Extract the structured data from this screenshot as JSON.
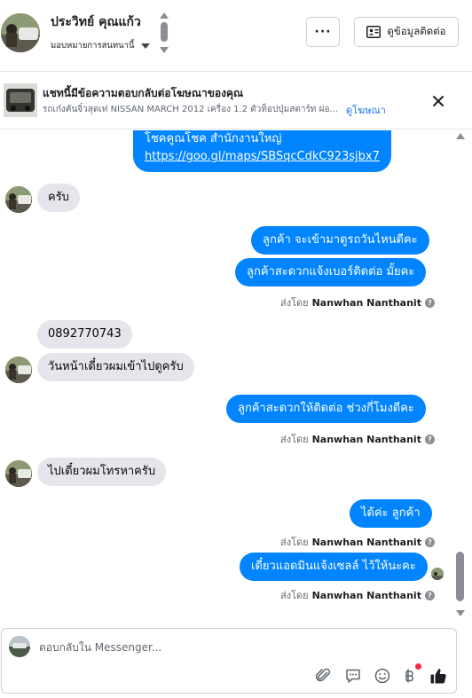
{
  "header": {
    "contact_name": "ประวิทย์ คุณแก้ว",
    "assign_label": "มอบหมายการสนทนานี้",
    "more_label": "···",
    "view_contact_label": "ดูข้อมูลติดต่อ"
  },
  "ad_banner": {
    "title": "แชทนี้มีข้อความตอบกลับต่อโฆษณาของคุณ",
    "subtitle": "รถเก๋งคันจิ๋วสุดเท่ NISSAN MARCH 2012 เครื่อง 1.2 ตัวท็อปปุ่มสตาร์ท ผ่อ...",
    "see_ad_label": "ดูโฆษณา"
  },
  "messages": {
    "m1_line1": "โชคคูณโชค สำนักงานใหญ่",
    "m1_link": "https://goo.gl/maps/SBSqcCdkC923sjbx7",
    "m2": "ครับ",
    "m3": "ลูกค้า จะเข้ามาดูรถวันไหนดีคะ",
    "m4": "ลูกค้าสะดวกแจ้งเบอร์ติดต่อ มั้ยคะ",
    "m5": "0892770743",
    "m6": "วันหน้าเดี๋ยวผมเข้าไปดูครับ",
    "m7": "ลูกค้าสะดวกให้ติดต่อ ช่วงกี่โมงดีคะ",
    "m8": "ไปเดี๋ยวผมโทรหาครับ",
    "m9": "ได้ค่ะ ลูกค้า",
    "m10": "เดี๋ยวแอดมินแจ้งเซลล์ ไว้ให้นะคะ"
  },
  "sent_by": {
    "prefix": "ส่งโดย",
    "sender": "Nanwhan Nanthanit",
    "help": "?"
  },
  "composer": {
    "placeholder": "ตอบกลับใน Messenger..."
  },
  "icons": {
    "attach": "paperclip-icon",
    "saved_replies": "chat-bubble-icon",
    "emoji": "smiley-icon",
    "payment": "baht-icon",
    "like": "thumbs-up-icon"
  },
  "colors": {
    "outgoing_bubble": "#0084ff",
    "incoming_bubble": "#e4e6eb",
    "link_blue": "#1b74e4",
    "notification_dot": "#f02849"
  }
}
